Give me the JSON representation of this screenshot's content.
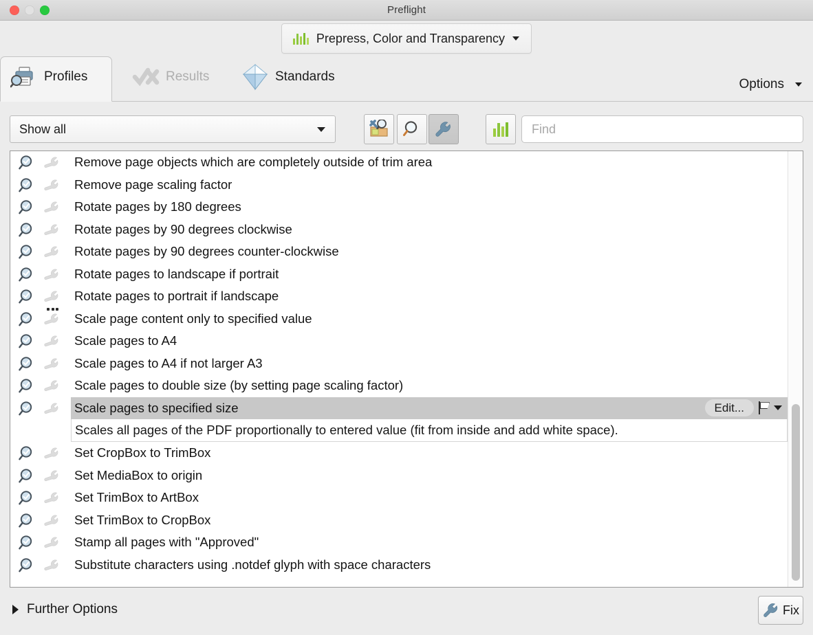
{
  "window": {
    "title": "Preflight",
    "traffic_lights": [
      "close",
      "minimize",
      "zoom"
    ]
  },
  "profile_selector": {
    "label": "Prepress, Color and Transparency",
    "icon": "bar-chart-icon",
    "bar_colors": [
      "#8cc63f",
      "#a8d14a",
      "#7fbf2f",
      "#b5d95c",
      "#8cc63f"
    ]
  },
  "tabs": [
    {
      "id": "profiles",
      "label": "Profiles",
      "icon": "printer-magnifier-icon",
      "active": true,
      "disabled": false
    },
    {
      "id": "results",
      "label": "Results",
      "icon": "checkmark-cross-icon",
      "active": false,
      "disabled": true
    },
    {
      "id": "standards",
      "label": "Standards",
      "icon": "blue-diamond-icon",
      "active": false,
      "disabled": false
    }
  ],
  "options_menu": {
    "label": "Options",
    "icon": "chevron-down-icon"
  },
  "toolbar": {
    "filter_select": {
      "value": "Show all",
      "icon": "chevron-down-icon"
    },
    "buttons": [
      {
        "id": "fix-all",
        "icon": "wrench-folder-icon",
        "pressed": false
      },
      {
        "id": "check",
        "icon": "magnifier-icon",
        "pressed": false
      },
      {
        "id": "fixup",
        "icon": "wrench-icon",
        "pressed": true
      },
      {
        "id": "profile-icon",
        "icon": "bar-chart-icon",
        "pressed": false
      }
    ],
    "find": {
      "placeholder": "Find",
      "value": ""
    }
  },
  "list": {
    "rows": [
      {
        "text": "Remove page objects which are completely outside of trim area",
        "check_icon": "magnifier-check-icon",
        "fix_icon": "wrench-icon",
        "has_dots": false,
        "selected": false
      },
      {
        "text": "Remove page scaling factor",
        "check_icon": "magnifier-check-icon",
        "fix_icon": "wrench-icon",
        "has_dots": false,
        "selected": false
      },
      {
        "text": "Rotate pages by 180 degrees",
        "check_icon": "magnifier-check-icon",
        "fix_icon": "wrench-icon",
        "has_dots": false,
        "selected": false
      },
      {
        "text": "Rotate pages by 90 degrees clockwise",
        "check_icon": "magnifier-check-icon",
        "fix_icon": "wrench-icon",
        "has_dots": false,
        "selected": false
      },
      {
        "text": "Rotate pages by 90 degrees counter-clockwise",
        "check_icon": "magnifier-check-icon",
        "fix_icon": "wrench-icon",
        "has_dots": false,
        "selected": false
      },
      {
        "text": "Rotate pages to landscape if portrait",
        "check_icon": "magnifier-check-icon",
        "fix_icon": "wrench-icon",
        "has_dots": false,
        "selected": false
      },
      {
        "text": "Rotate pages to portrait if landscape",
        "check_icon": "magnifier-check-icon",
        "fix_icon": "wrench-icon",
        "has_dots": false,
        "selected": false
      },
      {
        "text": "Scale page content only to specified value",
        "check_icon": "magnifier-check-icon",
        "fix_icon": "wrench-icon",
        "has_dots": true,
        "selected": false
      },
      {
        "text": "Scale pages to A4",
        "check_icon": "magnifier-check-icon",
        "fix_icon": "wrench-icon",
        "has_dots": false,
        "selected": false
      },
      {
        "text": "Scale pages to A4 if not larger A3",
        "check_icon": "magnifier-check-icon",
        "fix_icon": "wrench-icon",
        "has_dots": false,
        "selected": false
      },
      {
        "text": "Scale pages to double size (by setting page scaling factor)",
        "check_icon": "magnifier-check-icon",
        "fix_icon": "wrench-icon",
        "has_dots": false,
        "selected": false
      },
      {
        "text": "Scale pages to specified size",
        "check_icon": "magnifier-check-icon",
        "fix_icon": "wrench-icon",
        "has_dots": false,
        "selected": true
      },
      {
        "text": "Set CropBox to TrimBox",
        "check_icon": "magnifier-check-icon",
        "fix_icon": "wrench-icon",
        "has_dots": false,
        "selected": false
      },
      {
        "text": "Set MediaBox to origin",
        "check_icon": "magnifier-check-icon",
        "fix_icon": "wrench-icon",
        "has_dots": false,
        "selected": false
      },
      {
        "text": "Set TrimBox to ArtBox",
        "check_icon": "magnifier-check-icon",
        "fix_icon": "wrench-icon",
        "has_dots": false,
        "selected": false
      },
      {
        "text": "Set TrimBox to CropBox",
        "check_icon": "magnifier-check-icon",
        "fix_icon": "wrench-icon",
        "has_dots": false,
        "selected": false
      },
      {
        "text": "Stamp all pages with \"Approved\"",
        "check_icon": "magnifier-check-icon",
        "fix_icon": "wrench-icon",
        "has_dots": false,
        "selected": false
      },
      {
        "text": "Substitute characters using .notdef glyph with space characters",
        "check_icon": "magnifier-check-icon",
        "fix_icon": "wrench-icon",
        "has_dots": false,
        "selected": false
      }
    ],
    "selected_row_actions": {
      "edit_label": "Edit...",
      "flag_icon": "flag-icon",
      "flag_caret_icon": "chevron-down-icon"
    },
    "description": "Scales all pages of the PDF proportionally to entered value (fit from inside and add white space)."
  },
  "footer": {
    "further_options_label": "Further Options",
    "disclosure_icon": "disclosure-triangle-right-icon",
    "fix_button": {
      "label": "Fix",
      "icon": "wrench-icon"
    }
  },
  "colors": {
    "window_bg": "#ececec",
    "list_bg": "#ffffff",
    "selection": "#c8c8c8",
    "accent_green": "#8cc63f",
    "icon_blue": "#6f92ab",
    "text": "#141414"
  }
}
